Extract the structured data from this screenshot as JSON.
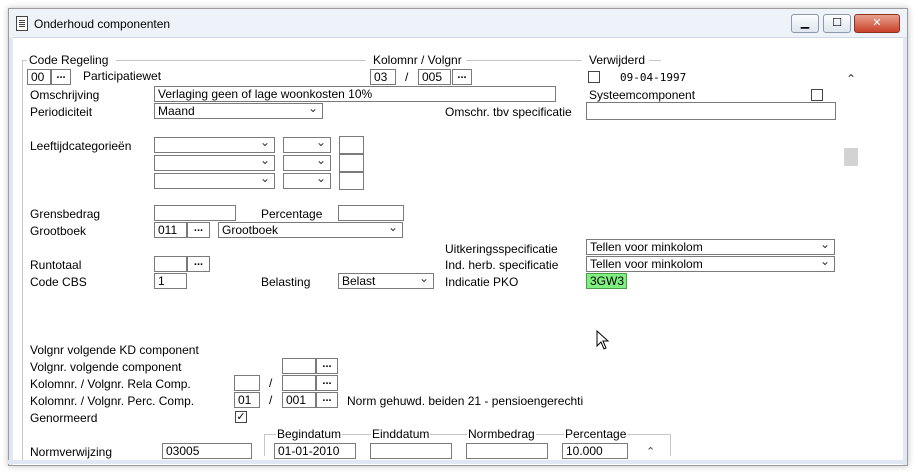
{
  "window": {
    "title": "Onderhoud componenten",
    "minimize": "▁",
    "maximize": "☐",
    "close": "✕"
  },
  "groups": {
    "code_regeling": "Code Regeling",
    "kolomnr_volgnr": "Kolomnr / Volgnr",
    "verwijderd": "Verwijderd"
  },
  "code_regeling": {
    "code": "00",
    "lookup": "...",
    "name": "Participatiewet"
  },
  "kolomnr": {
    "kolom": "03",
    "sep": "/",
    "volgnr": "005",
    "lookup": "..."
  },
  "verwijderd": {
    "date": "09-04-1997",
    "checked": false
  },
  "labels": {
    "omschrijving": "Omschrijving",
    "periodiciteit": "Periodiciteit",
    "omschr_tbv": "Omschr. tbv specificatie",
    "systeemcomponent": "Systeemcomponent",
    "leeftijdcategorieen": "Leeftijdcategorieën",
    "grensbedrag": "Grensbedrag",
    "percentage": "Percentage",
    "grootboek": "Grootboek",
    "uitkeringsspecificatie": "Uitkeringsspecificatie",
    "runtotaal": "Runtotaal",
    "ind_herb": "Ind. herb. specificatie",
    "code_cbs": "Code CBS",
    "belasting": "Belasting",
    "indicatie_pko": "Indicatie PKO",
    "volgnr_kd": "Volgnr volgende KD component",
    "volgnr_volgende": "Volgnr. volgende component",
    "kolom_rela": "Kolomnr. / Volgnr. Rela Comp.",
    "kolom_perc": "Kolomnr. / Volgnr. Perc. Comp.",
    "genormeerd": "Genormeerd",
    "normverwijzing": "Normverwijzing"
  },
  "values": {
    "omschrijving": "Verlaging geen of lage woonkosten 10%",
    "periodiciteit": "Maand",
    "omschr_tbv": "",
    "grensbedrag": "",
    "percentage": "",
    "grootboek_code": "011",
    "grootboek_name": "Grootboek",
    "uitkeringsspecificatie": "Tellen voor minkolom",
    "runtotaal": "",
    "ind_herb": "Tellen voor minkolom",
    "code_cbs": "1",
    "belasting": "Belast",
    "indicatie_pko": "3GW3",
    "perc_kolom": "01",
    "perc_sep": "/",
    "perc_volgnr": "001",
    "rela_sep": "/",
    "perc_desc": "Norm gehuwd.  beiden 21 - pensioengerechti",
    "genormeerd_check": "✓",
    "normverwijzing": "03005"
  },
  "table": {
    "headers": [
      "Begindatum",
      "Einddatum",
      "Normbedrag",
      "Percentage"
    ],
    "row": [
      "01-01-2010",
      "",
      "",
      "10.000"
    ]
  },
  "buttons": {
    "lookup": "..."
  },
  "icons": {
    "scroll_up": "⌃",
    "cursor": "arrow-cursor",
    "dropdown": "chevron-down-icon"
  }
}
